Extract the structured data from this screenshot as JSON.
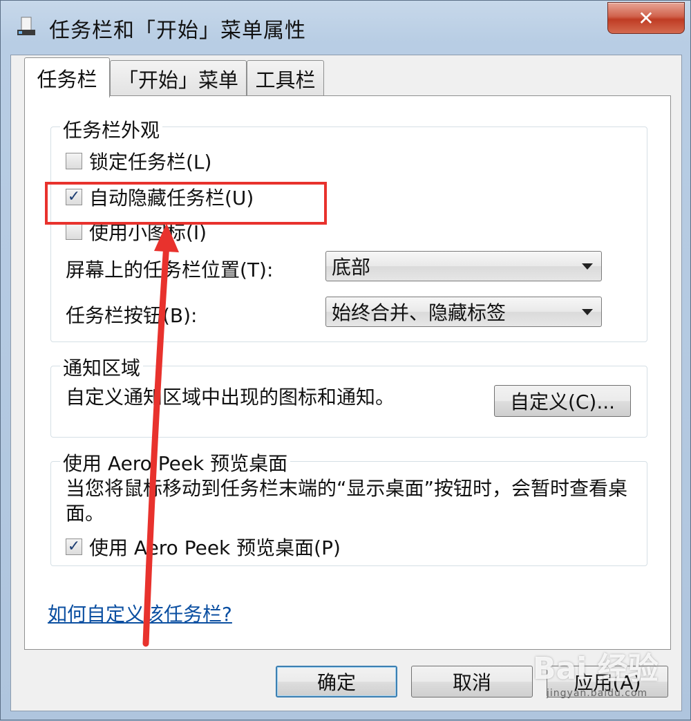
{
  "window": {
    "title": "任务栏和「开始」菜单属性",
    "close_symbol": "✕"
  },
  "tabs": [
    {
      "label": "任务栏",
      "active": true
    },
    {
      "label": "「开始」菜单",
      "active": false
    },
    {
      "label": "工具栏",
      "active": false
    }
  ],
  "appearance": {
    "group_label": "任务栏外观",
    "lock": {
      "label": "锁定任务栏(L)",
      "checked": false
    },
    "autohide": {
      "label": "自动隐藏任务栏(U)",
      "checked": true
    },
    "small_icons": {
      "label": "使用小图标(I)",
      "checked": false
    },
    "position_label": "屏幕上的任务栏位置(T):",
    "position_value": "底部",
    "buttons_label": "任务栏按钮(B):",
    "buttons_value": "始终合并、隐藏标签"
  },
  "notification": {
    "group_label": "通知区域",
    "description": "自定义通知区域中出现的图标和通知。",
    "customize_button": "自定义(C)..."
  },
  "peek": {
    "group_label": "使用 Aero Peek 预览桌面",
    "description": "当您将鼠标移动到任务栏末端的“显示桌面”按钮时，会暂时查看桌面。",
    "use_peek": {
      "label": "使用 Aero Peek 预览桌面(P)",
      "checked": true
    }
  },
  "help_link": "如何自定义该任务栏?",
  "footer": {
    "ok": "确定",
    "cancel": "取消",
    "apply": "应用(A)"
  },
  "watermark": {
    "text": "Bai 经验",
    "sub": "jingyan.baidu.com"
  },
  "check_mark": "✓",
  "colors": {
    "annotation": "#e8322d",
    "link": "#0b4fa1",
    "close_button": "#c8462e"
  }
}
